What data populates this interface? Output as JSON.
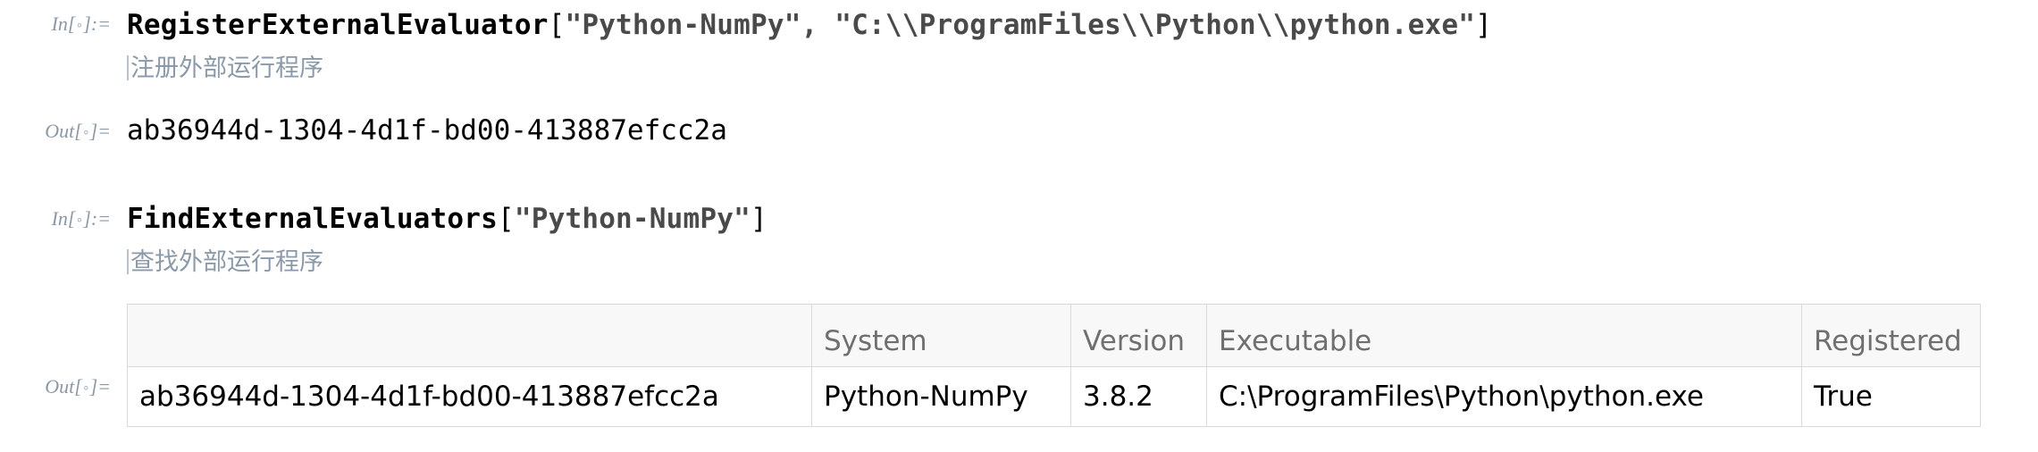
{
  "cells": {
    "in1": {
      "label": "In[",
      "label_dot": "∘",
      "label_end": "]:=",
      "function": "RegisterExternalEvaluator",
      "open": "[",
      "arg1": "\"Python-NumPy\"",
      "sep": ", ",
      "arg2": "\"C:\\\\ProgramFiles\\\\Python\\\\python.exe\"",
      "close": "]",
      "comment": "注册外部运行程序"
    },
    "out1": {
      "label": "Out[",
      "label_dot": "∘",
      "label_end": "]=",
      "value": "ab36944d-1304-4d1f-bd00-413887efcc2a"
    },
    "in2": {
      "label": "In[",
      "label_dot": "∘",
      "label_end": "]:=",
      "function": "FindExternalEvaluators",
      "open": "[",
      "arg1": "\"Python-NumPy\"",
      "close": "]",
      "comment": "查找外部运行程序"
    },
    "out2": {
      "label": "Out[",
      "label_dot": "∘",
      "label_end": "]=",
      "table": {
        "headers": [
          "",
          "System",
          "Version",
          "Executable",
          "Registered"
        ],
        "rows": [
          [
            "ab36944d-1304-4d1f-bd00-413887efcc2a",
            "Python-NumPy",
            "3.8.2",
            "C:\\ProgramFiles\\Python\\python.exe",
            "True"
          ]
        ]
      }
    }
  }
}
